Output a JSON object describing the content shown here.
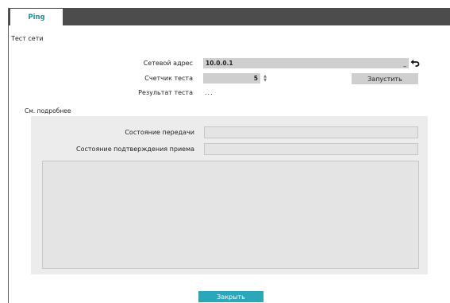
{
  "tab": {
    "label": "Ping"
  },
  "section": {
    "title": "Тест сети"
  },
  "address": {
    "label": "Сетевой адрес",
    "value": "10.0.0.1",
    "cursor": "_"
  },
  "count": {
    "label": "Счетчик теста",
    "value": "5"
  },
  "run_button": {
    "label": "Запустить"
  },
  "result": {
    "label": "Результат теста",
    "value": "..."
  },
  "details": {
    "title": "См. подробнее",
    "transmit_label": "Состояние передачи",
    "ack_label": "Состояние подтверждения приема"
  },
  "close_button": {
    "label": "Закрыть"
  },
  "colors": {
    "accent": "#2aa7b8",
    "tab_text": "#1a8fa3",
    "tabbar": "#4c4c4c"
  }
}
